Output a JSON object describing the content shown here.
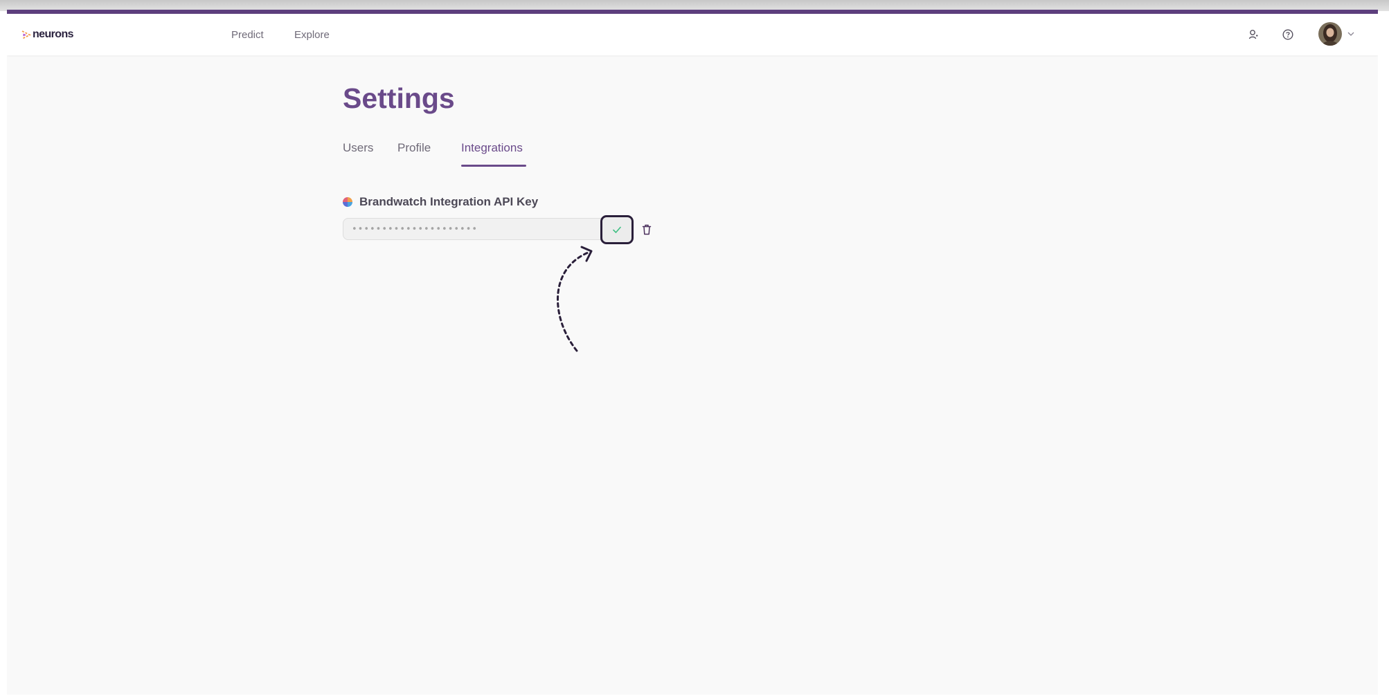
{
  "app": {
    "logo_text": "neurons",
    "accent_color": "#6a4a8a",
    "accent_bar_color": "#5d3f7d"
  },
  "nav": {
    "links": [
      {
        "label": "Predict"
      },
      {
        "label": "Explore"
      }
    ],
    "icons": [
      "user-icon",
      "help-icon",
      "avatar",
      "chevron-down-icon"
    ]
  },
  "page": {
    "title": "Settings",
    "tabs": [
      {
        "label": "Users",
        "active": false
      },
      {
        "label": "Profile",
        "active": false
      },
      {
        "label": "Integrations",
        "active": true
      }
    ]
  },
  "integration": {
    "label": "Brandwatch Integration API Key",
    "icon": "brandwatch-logo-icon",
    "masked_value": "•••••••••••••••••••••",
    "confirm_icon": "check-icon",
    "confirm_icon_color": "#3fbf83",
    "delete_icon": "trash-icon"
  }
}
